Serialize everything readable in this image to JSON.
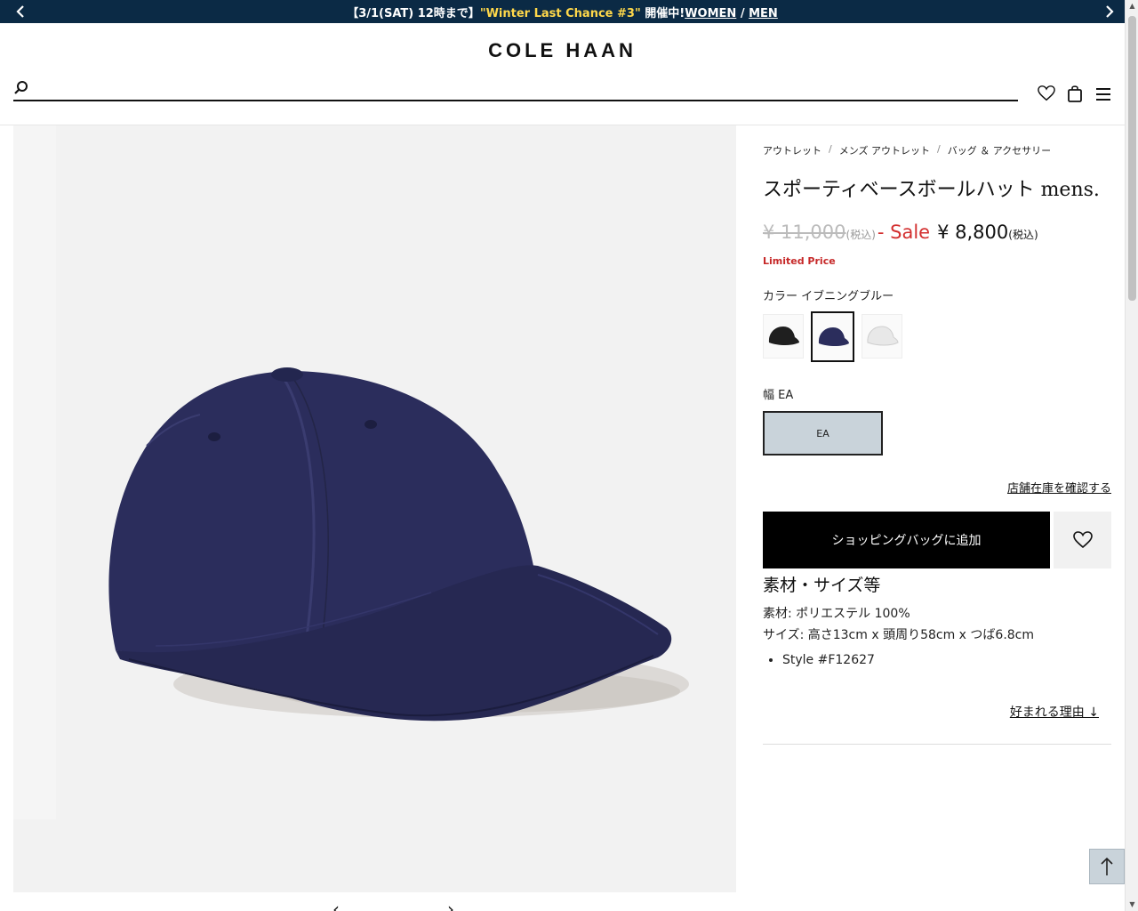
{
  "promo": {
    "prefix": "【3/1(SAT) 12時まで】",
    "campaign": "\"Winter Last Chance #3\"",
    "middle": " 開催中!",
    "women": "WOMEN",
    "slash": " / ",
    "men": "MEN",
    "prev_icon": "chevron-left",
    "next_icon": "chevron-right"
  },
  "header": {
    "logo": "COLE HAAN",
    "search_placeholder": "",
    "icons": [
      "search-icon",
      "heart-icon",
      "bag-icon",
      "menu-icon"
    ]
  },
  "breadcrumb": [
    "アウトレット",
    "メンズ アウトレット",
    "バッグ ＆ アクセサリー"
  ],
  "breadcrumb_sep": "/",
  "product": {
    "title": "スポーティベースボールハット mens.",
    "old_price": "¥ 11,000",
    "tax_label": "(税込)",
    "sale_label": "- Sale",
    "price": "¥ 8,800",
    "limited": "Limited Price",
    "color_label": "カラー",
    "color_value": "イブニングブルー",
    "swatches": [
      {
        "name": "black",
        "color": "#1f1f1f"
      },
      {
        "name": "navy",
        "color": "#2b2d5c"
      },
      {
        "name": "white",
        "color": "#e8e8e8"
      }
    ],
    "selected_swatch": 1,
    "width_label": "幅",
    "width_value": "EA",
    "width_option": "EA",
    "store_stock": "店舗在庫を確認する",
    "add_to_bag": "ショッピングバッグに追加"
  },
  "details": {
    "title": "素材・サイズ等",
    "material": "素材: ポリエステル 100%",
    "size": "サイズ: 高さ13cm x 頭周り58cm x つば6.8cm",
    "style": "Style #F12627",
    "why_link": "好まれる理由 ↓"
  },
  "colors": {
    "banner_bg": "#0b2a45",
    "campaign": "#ffd84a",
    "sale": "#d32f2f",
    "cap": "#2b2d5c"
  }
}
